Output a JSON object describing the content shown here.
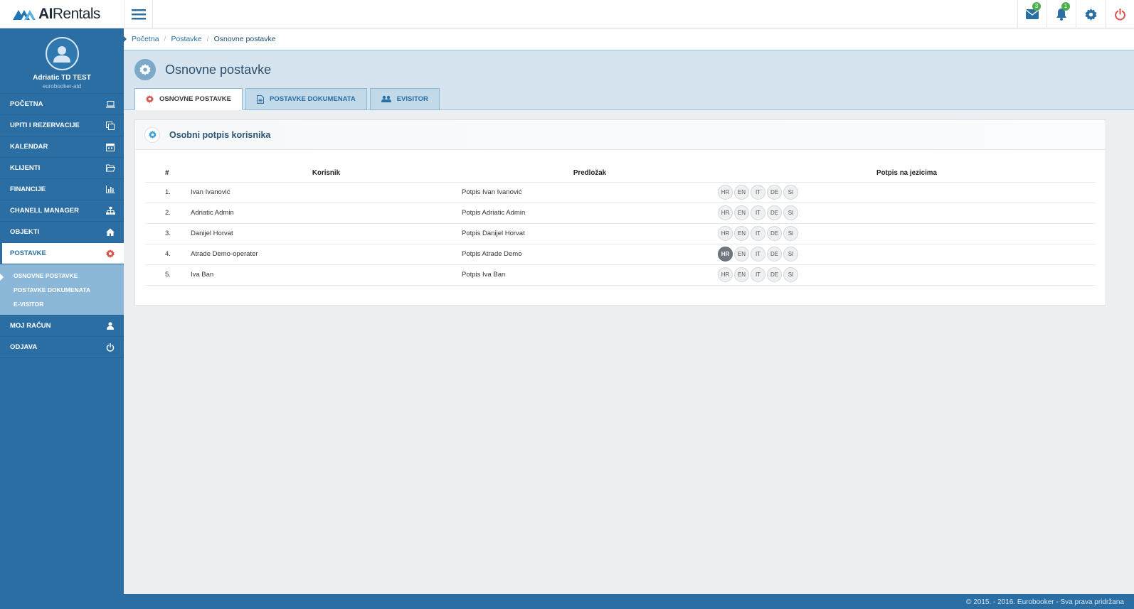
{
  "brand": {
    "logo_bold": "AI",
    "logo_rest": "Rentals"
  },
  "topbar": {
    "messages_count": "3",
    "notifications_count": "1"
  },
  "profile": {
    "name": "Adriatic TD TEST",
    "subtitle": "eurobooker-atd"
  },
  "sidebar": {
    "items": [
      {
        "label": "POČETNA",
        "icon": "laptop-icon"
      },
      {
        "label": "UPITI I REZERVACIJE",
        "icon": "copy-icon"
      },
      {
        "label": "KALENDAR",
        "icon": "calendar-icon"
      },
      {
        "label": "KLIJENTI",
        "icon": "folder-open-icon"
      },
      {
        "label": "FINANCIJE",
        "icon": "bar-chart-icon"
      },
      {
        "label": "CHANELL MANAGER",
        "icon": "sitemap-icon"
      },
      {
        "label": "OBJEKTI",
        "icon": "home-icon"
      },
      {
        "label": "POSTAVKE",
        "icon": "gear-icon"
      },
      {
        "label": "MOJ RAČUN",
        "icon": "user-icon"
      },
      {
        "label": "ODJAVA",
        "icon": "power-icon"
      }
    ],
    "submenu": [
      "OSNOVNE POSTAVKE",
      "POSTAVKE DOKUMENATA",
      "E-VISITOR"
    ]
  },
  "breadcrumb": [
    "Početna",
    "Postavke",
    "Osnovne postavke"
  ],
  "page": {
    "title": "Osnovne postavke"
  },
  "tabs": [
    "OSNOVNE POSTAVKE",
    "POSTAVKE DOKUMENATA",
    "EVISITOR"
  ],
  "panel": {
    "title": "Osobni potpis korisnika"
  },
  "table": {
    "headers": [
      "#",
      "Korisnik",
      "Predložak",
      "Potpis na jezicima"
    ],
    "rows": [
      {
        "num": "1.",
        "user": "Ivan Ivanović",
        "template": "Potpis Ivan Ivanović",
        "active_lang": ""
      },
      {
        "num": "2.",
        "user": "Adriatic Admin",
        "template": "Potpis Adriatic Admin",
        "active_lang": ""
      },
      {
        "num": "3.",
        "user": "Danijel Horvat",
        "template": "Potpis Danijel Horvat",
        "active_lang": ""
      },
      {
        "num": "4.",
        "user": "Atrade Demo-operater",
        "template": "Potpis Atrade Demo",
        "active_lang": "HR"
      },
      {
        "num": "5.",
        "user": "Iva Ban",
        "template": "Potpis Iva Ban",
        "active_lang": ""
      }
    ],
    "languages": [
      "HR",
      "EN",
      "IT",
      "DE",
      "SI"
    ]
  },
  "footer": {
    "text": "© 2015. - 2016. Eurobooker - Sva prava pridržana"
  },
  "colors": {
    "primary": "#2a6ea3",
    "submenu": "#8bb8d9",
    "page_head": "#d5e4ef",
    "accent_red": "#d9534f",
    "badge_green": "#4cae4c"
  }
}
